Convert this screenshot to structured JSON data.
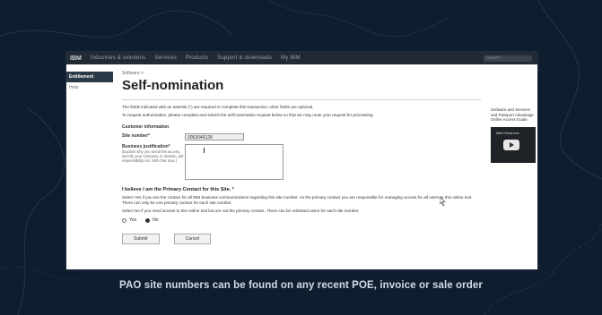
{
  "nav": {
    "brand": "IBM",
    "items": [
      "Industries & solutions",
      "Services",
      "Products",
      "Support & downloads",
      "My IBM"
    ],
    "search_placeholder": "Search"
  },
  "leftnav": {
    "items": [
      "Entitlement",
      "Help"
    ]
  },
  "page": {
    "breadcrumb": "Software >",
    "title": "Self-nomination",
    "required_note": "The fields indicated with an asterisk (*) are required to complete this transaction; other fields are optional.",
    "intro": "To request authorization, please complete and submit the self-nomination request below so that we may route your request for processing.",
    "section_label": "Customer information",
    "site_number_label": "Site number*",
    "site_number_value": "0063046128",
    "justification_label": "Business justification*",
    "justification_help": "(Explain why you need this access, specify your company or division, job responsibility etc. 500 char max.)",
    "primary_title": "I believe I am the Primary Contact for this Site. *",
    "primary_desc_yes": "Select Yes if you are the contact for all IBM business communications regarding this site number. As the primary contact you are responsible for managing access for all users to this online tool. There can only be one primary contact for each site number.",
    "primary_desc_no": "Select No if you need access to this online tool but are not the primary contact. There can be unlimited users for each site number.",
    "radio_yes": "Yes",
    "radio_no": "No",
    "submit_label": "Submit",
    "cancel_label": "Cancel"
  },
  "sidebar": {
    "text": "Software and Services and Passport Advantage Online Access Guide",
    "video_title": "IBM Electronic"
  },
  "caption": "PAO site numbers can be found on any recent POE, invoice or sale order",
  "colors": {
    "background": "#0f1e2e",
    "caption": "#d2dbe5",
    "topnav": "#222a33"
  }
}
